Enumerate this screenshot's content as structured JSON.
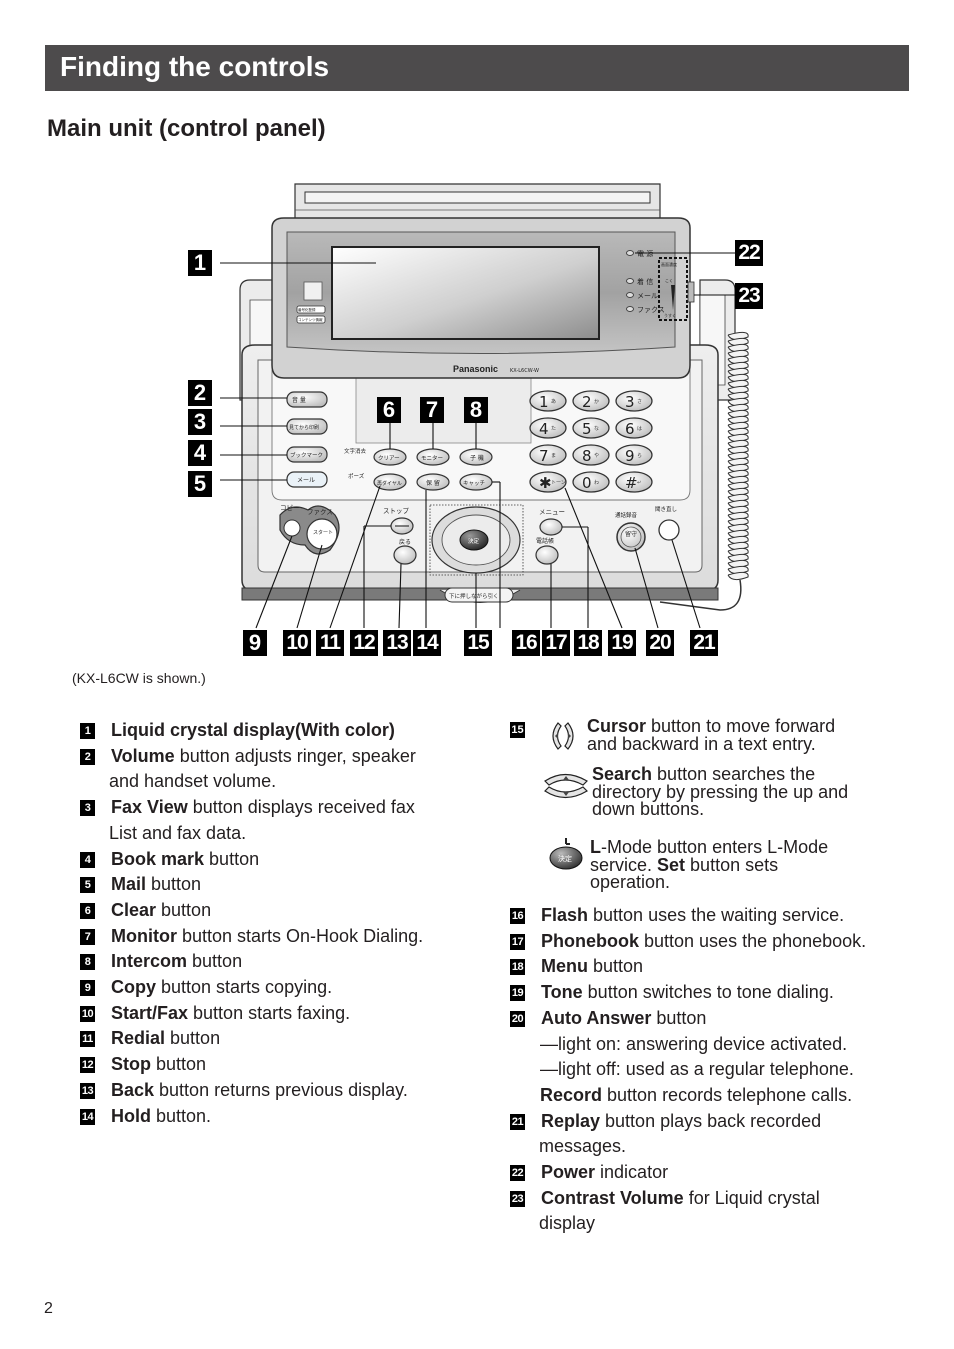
{
  "header": {
    "title": "Finding the controls",
    "subtitle": "Main unit (control panel)"
  },
  "figure": {
    "caption": "(KX-L6CW is shown.)",
    "brand": "Panasonic",
    "model": "KX-L6CW-W",
    "panel_labels": {
      "indicator_power": "電 源",
      "indicator_incoming": "着 信",
      "indicator_mail": "メール",
      "indicator_fax": "ファクス",
      "contrast_label": "画面濃度",
      "contrast_dark": "こく",
      "contrast_light": "うすく",
      "btn_volume": "音 量",
      "btn_faxview": "見てから印刷",
      "btn_bookmark": "ブックマーク",
      "btn_mail": "メール",
      "label_char_delete": "文字消去",
      "label_pause": "ポーズ",
      "btn_clear": "クリアー",
      "btn_monitor": "モニター",
      "btn_intercom": "子 機",
      "btn_redial": "再ダイヤル",
      "btn_hold": "保 留",
      "btn_catch": "キャッチ",
      "label_copy": "コピー",
      "label_fax": "ファクス",
      "btn_start": "スタート",
      "label_stop": "ストップ",
      "label_back": "戻る",
      "btn_set": "決定",
      "label_menu": "メニュー",
      "label_phonebook": "電話帳",
      "label_record": "通話録音",
      "btn_answer": "留守",
      "label_replay": "聞き直し",
      "tray_label": "下に押しながら引く",
      "side_button_1": "番号化登録",
      "side_button_2": "コンテンツ情報"
    },
    "keypad": [
      {
        "digit": "1",
        "sub": "あ"
      },
      {
        "digit": "2",
        "sub": "か"
      },
      {
        "digit": "3",
        "sub": "さ"
      },
      {
        "digit": "4",
        "sub": "た"
      },
      {
        "digit": "5",
        "sub": "な"
      },
      {
        "digit": "6",
        "sub": "は"
      },
      {
        "digit": "7",
        "sub": "ま"
      },
      {
        "digit": "8",
        "sub": "や"
      },
      {
        "digit": "9",
        "sub": "ら"
      },
      {
        "digit": "✱",
        "sub": "トーン"
      },
      {
        "digit": "0",
        "sub": "わ"
      },
      {
        "digit": "#",
        "sub": "↵"
      }
    ],
    "callouts": [
      "1",
      "2",
      "3",
      "4",
      "5",
      "6",
      "7",
      "8",
      "9",
      "10",
      "11",
      "12",
      "13",
      "14",
      "15",
      "16",
      "17",
      "18",
      "19",
      "20",
      "21",
      "22",
      "23"
    ]
  },
  "items_left": [
    {
      "num": "1",
      "bold": "Liquid crystal display(With color)",
      "rest": "",
      "cont": ""
    },
    {
      "num": "2",
      "bold": "Volume",
      "rest": " button adjusts ringer, speaker",
      "cont": "and handset volume."
    },
    {
      "num": "3",
      "bold": "Fax View",
      "rest": "  button displays received fax",
      "cont": "List and fax data."
    },
    {
      "num": "4",
      "bold": "Book mark",
      "rest": " button",
      "cont": ""
    },
    {
      "num": "5",
      "bold": "Mail",
      "rest": " button",
      "cont": ""
    },
    {
      "num": "6",
      "bold": "Clear",
      "rest": " button",
      "cont": ""
    },
    {
      "num": "7",
      "bold": "Monitor",
      "rest": " button starts On-Hook Dialing.",
      "cont": ""
    },
    {
      "num": "8",
      "bold": "Intercom",
      "rest": " button",
      "cont": ""
    },
    {
      "num": "9",
      "bold": "Copy",
      "rest": " button starts copying.",
      "cont": ""
    },
    {
      "num": "10",
      "bold": "Start/Fax",
      "rest": " button starts faxing.",
      "cont": ""
    },
    {
      "num": "11",
      "bold": "Redial",
      "rest": " button",
      "cont": ""
    },
    {
      "num": "12",
      "bold": "Stop",
      "rest": " button",
      "cont": ""
    },
    {
      "num": "13",
      "bold": "Back",
      "rest": " button returns previous display.",
      "cont": ""
    },
    {
      "num": "14",
      "bold": "Hold",
      "rest": " button.",
      "cont": ""
    }
  ],
  "item15": {
    "num": "15",
    "cursor": {
      "bold": "Cursor",
      "rest": " button to move forward",
      "line2": "and backward in a text entry."
    },
    "search": {
      "bold": "Search",
      "rest": " button searches the",
      "line2": "directory by pressing the up and",
      "line3": "down buttons."
    },
    "lmode": {
      "bold_l": "L",
      "rest1": "-Mode button enters L-Mode",
      "pre2": "service. ",
      "bold_set": "Set",
      "rest2": " button sets",
      "line3": "operation."
    },
    "set_icon_label": "決定"
  },
  "items_right": [
    {
      "num": "16",
      "bold": "Flash",
      "rest": " button uses the waiting service.",
      "cont": []
    },
    {
      "num": "17",
      "bold": "Phonebook",
      "rest": " button uses the phonebook.",
      "cont": []
    },
    {
      "num": "18",
      "bold": "Menu",
      "rest": " button",
      "cont": []
    },
    {
      "num": "19",
      "bold": "Tone",
      "rest": " button switches to tone dialing.",
      "cont": []
    },
    {
      "num": "20",
      "bold": "Auto Answer",
      "rest": " button",
      "cont": []
    }
  ],
  "item20_extra": {
    "light_on": "—light on: answering device activated.",
    "light_off": "—light off: used as a regular telephone.",
    "record_bold": "Record",
    "record_rest": " button records telephone calls."
  },
  "items_right_tail": [
    {
      "num": "21",
      "bold": "Replay",
      "rest": " button plays back recorded",
      "cont": "messages."
    },
    {
      "num": "22",
      "bold": "Power",
      "rest": " indicator",
      "cont": ""
    },
    {
      "num": "23",
      "bold": "Contrast Volume",
      "rest": " for Liquid crystal",
      "cont": "display"
    }
  ],
  "footer": {
    "page_number": "2"
  }
}
